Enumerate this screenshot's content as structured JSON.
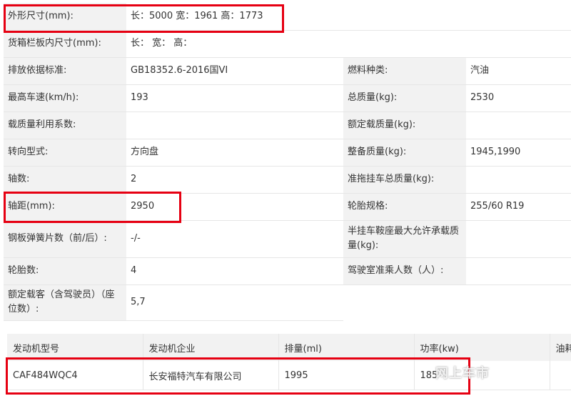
{
  "spec_rows": [
    {
      "l1": "外形尺寸(mm):",
      "v1": "长：5000 宽：1961 高：1773",
      "l2": "",
      "v2": ""
    },
    {
      "l1": "货箱栏板内尺寸(mm):",
      "v1": "长：  宽：  高：",
      "l2": "",
      "v2": ""
    },
    {
      "l1": "排放依据标准:",
      "v1": "GB18352.6-2016国VI",
      "l2": "燃料种类:",
      "v2": "汽油"
    },
    {
      "l1": "最高车速(km/h):",
      "v1": "193",
      "l2": "总质量(kg):",
      "v2": "2530"
    },
    {
      "l1": "载质量利用系数:",
      "v1": "",
      "l2": "额定载质量(kg):",
      "v2": ""
    },
    {
      "l1": "转向型式:",
      "v1": "方向盘",
      "l2": "整备质量(kg):",
      "v2": "1945,1990"
    },
    {
      "l1": "轴数:",
      "v1": "2",
      "l2": "准拖挂车总质量(kg):",
      "v2": ""
    },
    {
      "l1": "轴距(mm):",
      "v1": "2950",
      "l2": "轮胎规格:",
      "v2": "255/60 R19"
    },
    {
      "l1": "钢板弹簧片数（前/后）:",
      "v1": "-/-",
      "l2": "半挂车鞍座最大允许承载质量(kg):",
      "v2": ""
    },
    {
      "l1": "轮胎数:",
      "v1": "4",
      "l2": "驾驶室准乘人数（人）:",
      "v2": ""
    },
    {
      "l1": "额定载客（含驾驶员）（座位数）:",
      "v1": "5,7",
      "l2": "",
      "v2": ""
    }
  ],
  "engine": {
    "headers": [
      "发动机型号",
      "发动机企业",
      "排量(ml)",
      "功率(kw)",
      "油耗"
    ],
    "row": [
      "CAF484WQC4",
      "长安福特汽车有限公司",
      "1995",
      "185",
      ""
    ]
  },
  "watermark": "网上车市",
  "colors": {
    "highlight": "#e60012",
    "label_bg": "#f2f2f2",
    "border": "#e6e6e6"
  }
}
